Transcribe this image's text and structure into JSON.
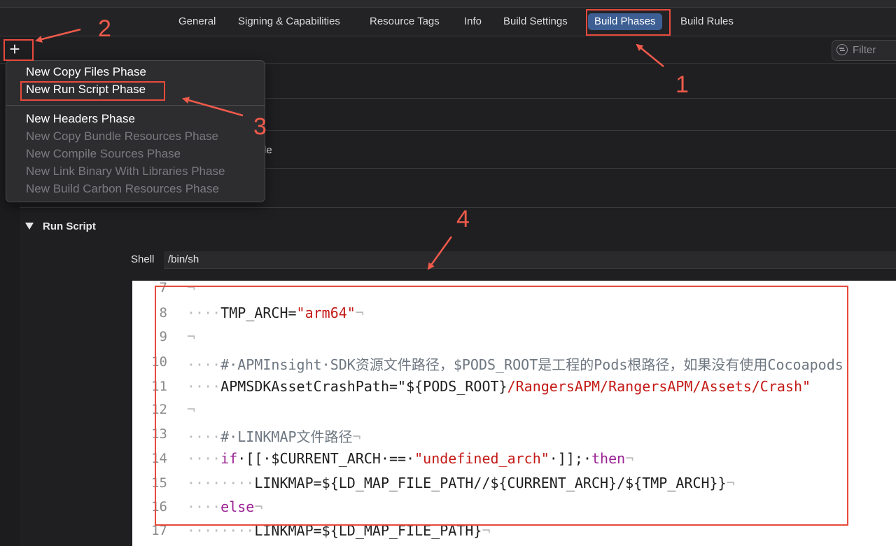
{
  "tabs": [
    {
      "label": "General"
    },
    {
      "label": "Signing & Capabilities"
    },
    {
      "label": "Resource Tags"
    },
    {
      "label": "Info"
    },
    {
      "label": "Build Settings"
    },
    {
      "label": "Build Phases",
      "active": true
    },
    {
      "label": "Build Rules"
    }
  ],
  "toolbar": {
    "add_label": "+",
    "filter_placeholder": "Filter"
  },
  "menu": {
    "items": [
      {
        "label": "New Copy Files Phase",
        "enabled": true
      },
      {
        "label": "New Run Script Phase",
        "enabled": true
      },
      {
        "label": "New Headers Phase",
        "enabled": true
      },
      {
        "label": "New Copy Bundle Resources Phase",
        "enabled": false
      },
      {
        "label": "New Compile Sources Phase",
        "enabled": false
      },
      {
        "label": "New Link Binary With Libraries Phase",
        "enabled": false
      },
      {
        "label": "New Build Carbon Resources Phase",
        "enabled": false
      }
    ]
  },
  "partial_text": "le",
  "run_script": {
    "title": "Run Script",
    "shell_label": "Shell",
    "shell_value": "/bin/sh"
  },
  "editor": {
    "lines": [
      {
        "n": "7",
        "segs": [
          {
            "t": "¬",
            "c": "ws"
          }
        ]
      },
      {
        "n": "8",
        "segs": [
          {
            "t": "····",
            "c": "ws"
          },
          {
            "t": "TMP_ARCH=",
            "c": ""
          },
          {
            "t": "\"arm64\"",
            "c": "str"
          },
          {
            "t": "¬",
            "c": "ws"
          }
        ]
      },
      {
        "n": "9",
        "segs": [
          {
            "t": "¬",
            "c": "ws"
          }
        ]
      },
      {
        "n": "10",
        "segs": [
          {
            "t": "····",
            "c": "ws"
          },
          {
            "t": "#·APMInsight·SDK资源文件路径，$PODS_ROOT是工程的Pods根路径，如果没有使用Cocoapods",
            "c": "cm"
          }
        ]
      },
      {
        "n": "11",
        "segs": [
          {
            "t": "····",
            "c": "ws"
          },
          {
            "t": "APMSDKAssetCrashPath=\"${PODS_ROOT}",
            "c": ""
          },
          {
            "t": "/RangersAPM/RangersAPM/Assets/Crash\"",
            "c": "str"
          }
        ]
      },
      {
        "n": "12",
        "segs": [
          {
            "t": "¬",
            "c": "ws"
          }
        ]
      },
      {
        "n": "13",
        "segs": [
          {
            "t": "····",
            "c": "ws"
          },
          {
            "t": "#·LINKMAP文件路径",
            "c": "cm"
          },
          {
            "t": "¬",
            "c": "ws"
          }
        ]
      },
      {
        "n": "14",
        "segs": [
          {
            "t": "····",
            "c": "ws"
          },
          {
            "t": "if",
            "c": "kw"
          },
          {
            "t": "·[[·$CURRENT_ARCH·==·",
            "c": ""
          },
          {
            "t": "\"undefined_arch\"",
            "c": "str"
          },
          {
            "t": "·]];·",
            "c": ""
          },
          {
            "t": "then",
            "c": "kw"
          },
          {
            "t": "¬",
            "c": "ws"
          }
        ]
      },
      {
        "n": "15",
        "segs": [
          {
            "t": "········",
            "c": "ws"
          },
          {
            "t": "LINKMAP=${LD_MAP_FILE_PATH//${CURRENT_ARCH}/${TMP_ARCH}}",
            "c": ""
          },
          {
            "t": "¬",
            "c": "ws"
          }
        ]
      },
      {
        "n": "16",
        "segs": [
          {
            "t": "····",
            "c": "ws"
          },
          {
            "t": "else",
            "c": "kw"
          },
          {
            "t": "¬",
            "c": "ws"
          }
        ]
      },
      {
        "n": "17",
        "segs": [
          {
            "t": "········",
            "c": "ws"
          },
          {
            "t": "LINKMAP=${LD_MAP_FILE_PATH}",
            "c": ""
          },
          {
            "t": "¬",
            "c": "ws"
          }
        ]
      }
    ]
  },
  "annotations": [
    "1",
    "2",
    "3",
    "4"
  ],
  "colors": {
    "accent": "#3d5f94",
    "annotation": "#e84a3c",
    "background": "#1f1f22",
    "string": "#c41a16",
    "keyword": "#9b2393"
  }
}
